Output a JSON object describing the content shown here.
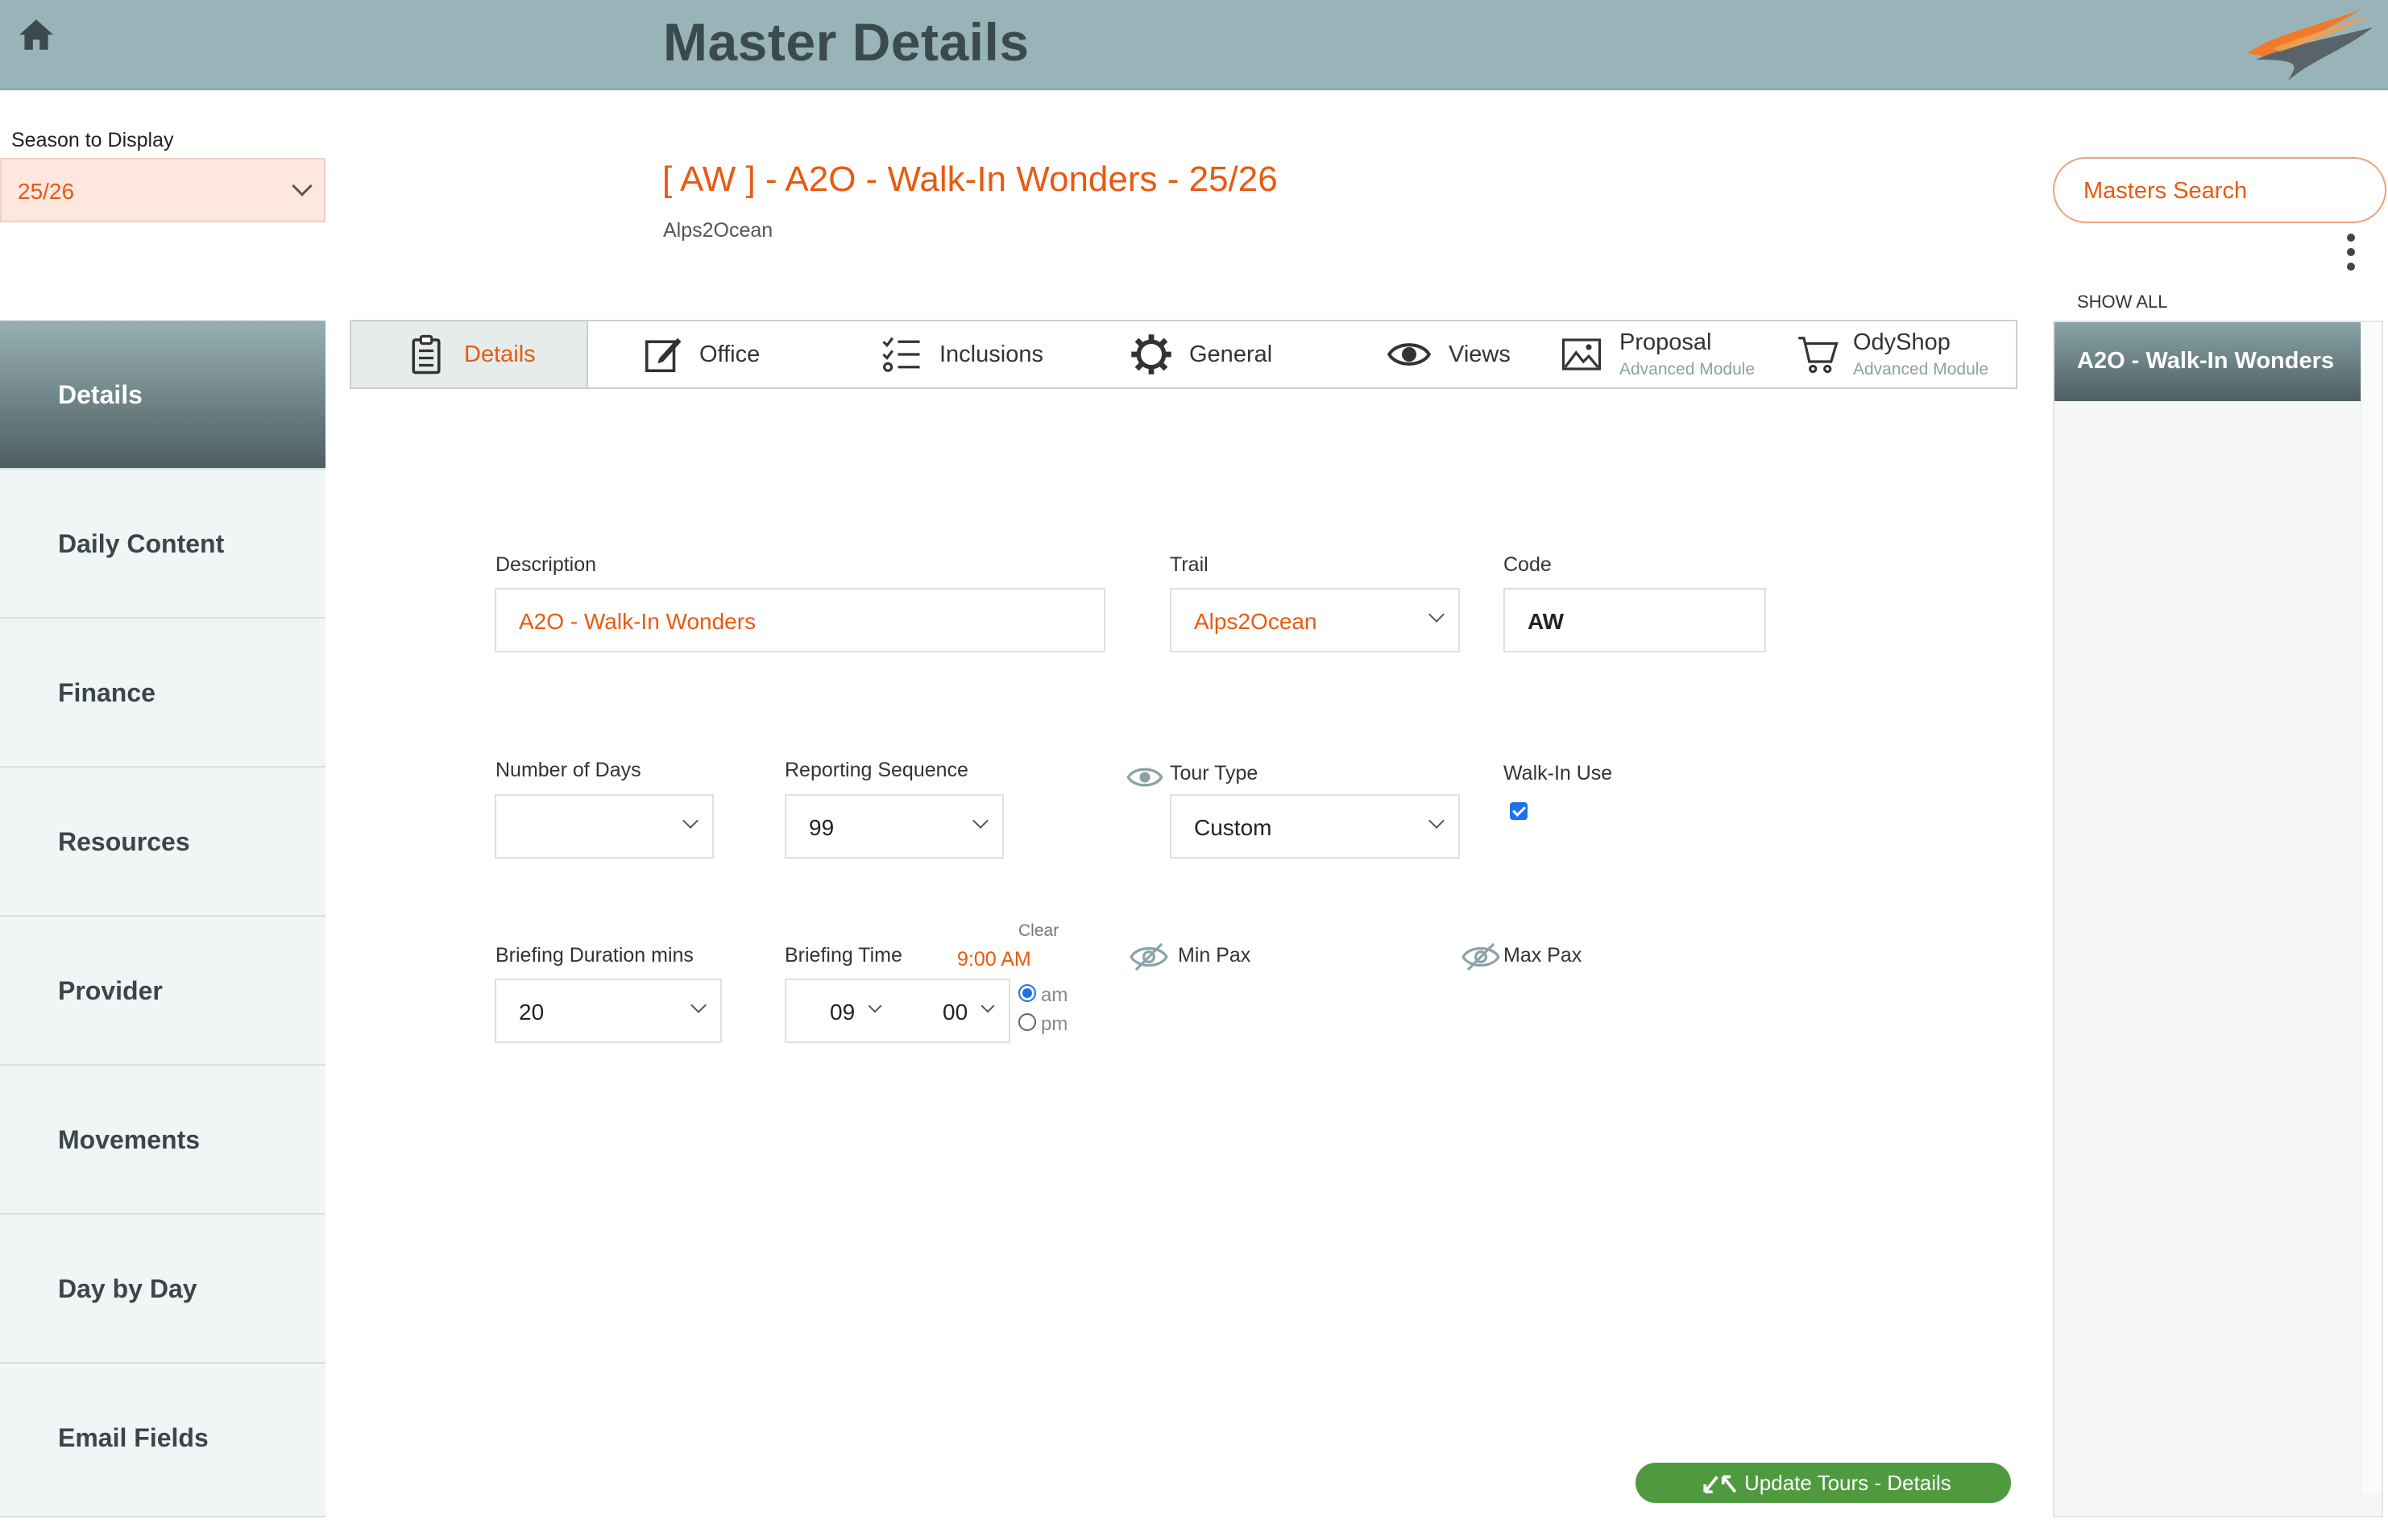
{
  "header": {
    "title": "Master Details",
    "home_icon": "home-icon",
    "logo": "swoosh-logo"
  },
  "season": {
    "label": "Season to Display",
    "value": "25/26"
  },
  "master": {
    "title": "[ AW ] - A2O - Walk-In Wonders - 25/26",
    "subtitle": "Alps2Ocean"
  },
  "right": {
    "masters_search": "Masters Search",
    "show_all": "SHOW ALL",
    "active_master": "A2O - Walk-In Wonders"
  },
  "sidebar": {
    "items": [
      {
        "label": "Details"
      },
      {
        "label": "Daily Content"
      },
      {
        "label": "Finance"
      },
      {
        "label": "Resources"
      },
      {
        "label": "Provider"
      },
      {
        "label": "Movements"
      },
      {
        "label": "Day by Day"
      },
      {
        "label": "Email Fields"
      }
    ]
  },
  "tabs": {
    "details": "Details",
    "office": "Office",
    "inclusions": "Inclusions",
    "general": "General",
    "views": "Views",
    "proposal": "Proposal",
    "proposal_sub": "Advanced Module",
    "odyshop": "OdyShop",
    "odyshop_sub": "Advanced Module"
  },
  "form": {
    "description_label": "Description",
    "description_value": "A2O - Walk-In Wonders",
    "trail_label": "Trail",
    "trail_value": "Alps2Ocean",
    "code_label": "Code",
    "code_value": "AW",
    "days_label": "Number of Days",
    "days_value": "",
    "seq_label": "Reporting Sequence",
    "seq_value": "99",
    "tour_type_label": "Tour Type",
    "tour_type_value": "Custom",
    "walkin_label": "Walk-In Use",
    "walkin_checked": true,
    "briefing_duration_label": "Briefing Duration mins",
    "briefing_duration_value": "20",
    "briefing_time_label": "Briefing Time",
    "briefing_time_display": "9:00 AM",
    "clear_label": "Clear",
    "hour": "09",
    "minute": "00",
    "am": "am",
    "pm": "pm",
    "min_pax_label": "Min Pax",
    "max_pax_label": "Max Pax"
  },
  "footer": {
    "update_button": "Update Tours - Details"
  },
  "colors": {
    "accent": "#e85a10",
    "header": "#98b4b8",
    "sidebar_active": "#4d5f63",
    "button_green": "#4f9a3f"
  }
}
